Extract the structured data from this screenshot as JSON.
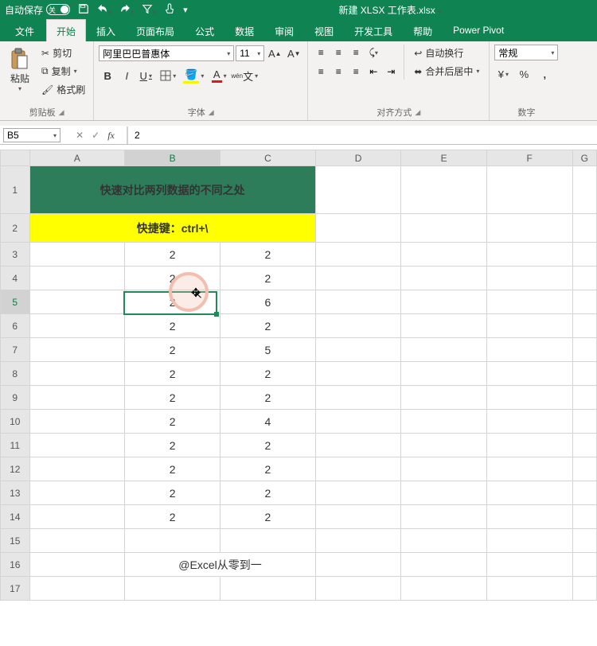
{
  "titlebar": {
    "autosave_label": "自动保存",
    "autosave_state": "关",
    "filename": "新建 XLSX 工作表.xlsx"
  },
  "tabs": {
    "file": "文件",
    "home": "开始",
    "insert": "插入",
    "page_layout": "页面布局",
    "formulas": "公式",
    "data": "数据",
    "review": "审阅",
    "view": "视图",
    "developer": "开发工具",
    "help": "帮助",
    "power_pivot": "Power Pivot"
  },
  "ribbon": {
    "clipboard": {
      "paste": "粘贴",
      "cut": "剪切",
      "copy": "复制",
      "format_painter": "格式刷",
      "group": "剪贴板"
    },
    "font": {
      "name": "阿里巴巴普惠体",
      "size": "11",
      "bold": "B",
      "italic": "I",
      "underline": "U",
      "group": "字体"
    },
    "align": {
      "wrap": "自动换行",
      "merge": "合并后居中",
      "group": "对齐方式"
    },
    "number": {
      "format": "常规",
      "group": "数字"
    }
  },
  "namebox": "B5",
  "formula_value": "2",
  "chart_data": {
    "type": "table",
    "columns": [
      "A",
      "B",
      "C",
      "D",
      "E",
      "F",
      "G"
    ],
    "title_merged": "快速对比两列数据的不同之处",
    "subtitle_merged": "快捷键：ctrl+\\",
    "rows": [
      {
        "r": 3,
        "B": "2",
        "C": "2"
      },
      {
        "r": 4,
        "B": "2",
        "C": "2"
      },
      {
        "r": 5,
        "B": "2",
        "C": "6"
      },
      {
        "r": 6,
        "B": "2",
        "C": "2"
      },
      {
        "r": 7,
        "B": "2",
        "C": "5"
      },
      {
        "r": 8,
        "B": "2",
        "C": "2"
      },
      {
        "r": 9,
        "B": "2",
        "C": "2"
      },
      {
        "r": 10,
        "B": "2",
        "C": "4"
      },
      {
        "r": 11,
        "B": "2",
        "C": "2"
      },
      {
        "r": 12,
        "B": "2",
        "C": "2"
      },
      {
        "r": 13,
        "B": "2",
        "C": "2"
      },
      {
        "r": 14,
        "B": "2",
        "C": "2"
      }
    ],
    "footer": "@Excel从零到一",
    "selected_cell": "B5"
  }
}
